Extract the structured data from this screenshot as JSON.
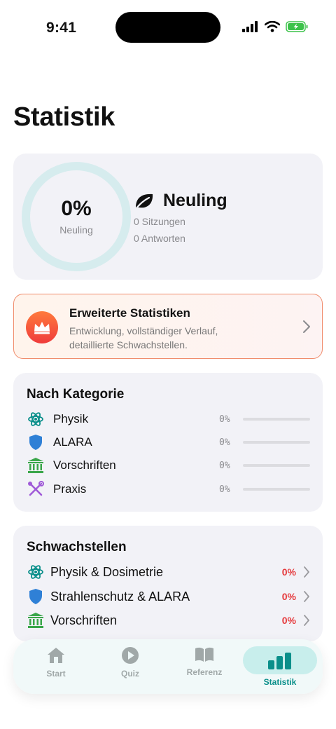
{
  "status": {
    "time": "9:41"
  },
  "page": {
    "title": "Statistik"
  },
  "summary": {
    "percent": "0%",
    "percent_value": 0,
    "level_sub": "Neuling",
    "level_title": "Neuling",
    "sessions": "0 Sitzungen",
    "answers": "0 Antworten"
  },
  "premium": {
    "title": "Erweiterte Statistiken",
    "description": "Entwicklung, vollständiger Verlauf, detaillierte Schwachstellen."
  },
  "categories": {
    "heading": "Nach Kategorie",
    "items": [
      {
        "label": "Physik",
        "percent": "0%",
        "value": 0,
        "icon": "atom-icon",
        "color": "#0a8f8a"
      },
      {
        "label": "ALARA",
        "percent": "0%",
        "value": 0,
        "icon": "shield-icon",
        "color": "#2f80d6"
      },
      {
        "label": "Vorschriften",
        "percent": "0%",
        "value": 0,
        "icon": "bank-icon",
        "color": "#3aa64a"
      },
      {
        "label": "Praxis",
        "percent": "0%",
        "value": 0,
        "icon": "tools-icon",
        "color": "#a05ad8"
      }
    ]
  },
  "weak": {
    "heading": "Schwachstellen",
    "items": [
      {
        "label": "Physik & Dosimetrie",
        "percent": "0%",
        "icon": "atom-icon"
      },
      {
        "label": "Strahlenschutz & ALARA",
        "percent": "0%",
        "icon": "shield-icon"
      },
      {
        "label": "Vorschriften",
        "percent": "0%",
        "icon": "bank-icon"
      }
    ]
  },
  "tabs": [
    {
      "label": "Start",
      "icon": "house-icon"
    },
    {
      "label": "Quiz",
      "icon": "play-icon"
    },
    {
      "label": "Referenz",
      "icon": "book-icon"
    },
    {
      "label": "Statistik",
      "icon": "chart-icon",
      "active": true
    }
  ],
  "colors": {
    "accent": "#0a8f8a",
    "danger": "#e5383b",
    "ring": "#d6ecee"
  }
}
